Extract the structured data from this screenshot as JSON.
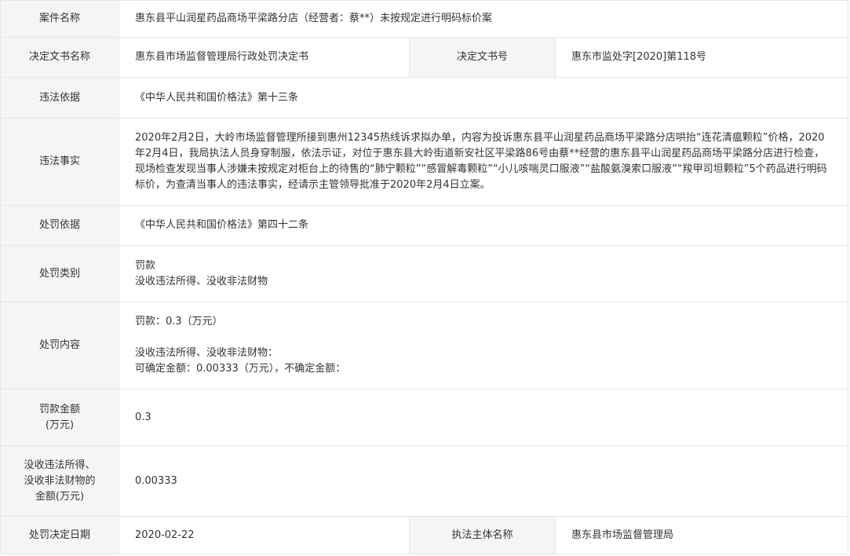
{
  "rows": {
    "case_name": {
      "label": "案件名称",
      "value": "惠东县平山润星药品商场平梁路分店（经营者：蔡**）未按规定进行明码标价案"
    },
    "decision": {
      "doc_label": "决定文书名称",
      "doc_value": "惠东县市场监督管理局行政处罚决定书",
      "no_label": "决定文书号",
      "no_value": "惠东市监处字[2020]第118号"
    },
    "basis": {
      "label": "违法依据",
      "value": "《中华人民共和国价格法》第十三条"
    },
    "facts": {
      "label": "违法事实",
      "value": "2020年2月2日，大岭市场监督管理所接到惠州12345热线诉求拟办单，内容为投诉惠东县平山润星药品商场平梁路分店哄抬“连花清瘟颗粒”价格，2020年2月4日，我局执法人员身穿制服，依法示证，对位于惠东县大岭街道新安社区平梁路86号由蔡**经营的惠东县平山润星药品商场平梁路分店进行检查，现场检查发现当事人涉嫌未按规定对柜台上的待售的“肺宁颗粒”“感冒解毒颗粒”“小儿咳喘灵口服液”“盐酸氨溴索口服液”“羧甲司坦颗粒”5个药品进行明码标价，为查清当事人的违法事实，经请示主管领导批准于2020年2月4日立案。"
    },
    "penalty_basis": {
      "label": "处罚依据",
      "value": "《中华人民共和国价格法》第四十二条"
    },
    "penalty_type": {
      "label": "处罚类别",
      "line1": "罚款",
      "line2": "没收违法所得、没收非法财物"
    },
    "penalty_content": {
      "label": "处罚内容",
      "line1": "罚款：0.3（万元）",
      "line2": "没收违法所得、没收非法财物：",
      "line3": "可确定金额：0.00333（万元），不确定金额："
    },
    "fine_amount": {
      "label_line1": "罚款金额",
      "label_line2": "(万元)",
      "value": "0.3"
    },
    "confiscation": {
      "label_line1": "没收违法所得、",
      "label_line2": "没收非法财物的",
      "label_line3": "金额(万元)",
      "value": "0.00333"
    },
    "footer": {
      "date_label": "处罚决定日期",
      "date_value": "2020-02-22",
      "agency_label": "执法主体名称",
      "agency_value": "惠东县市场监督管理局"
    }
  }
}
